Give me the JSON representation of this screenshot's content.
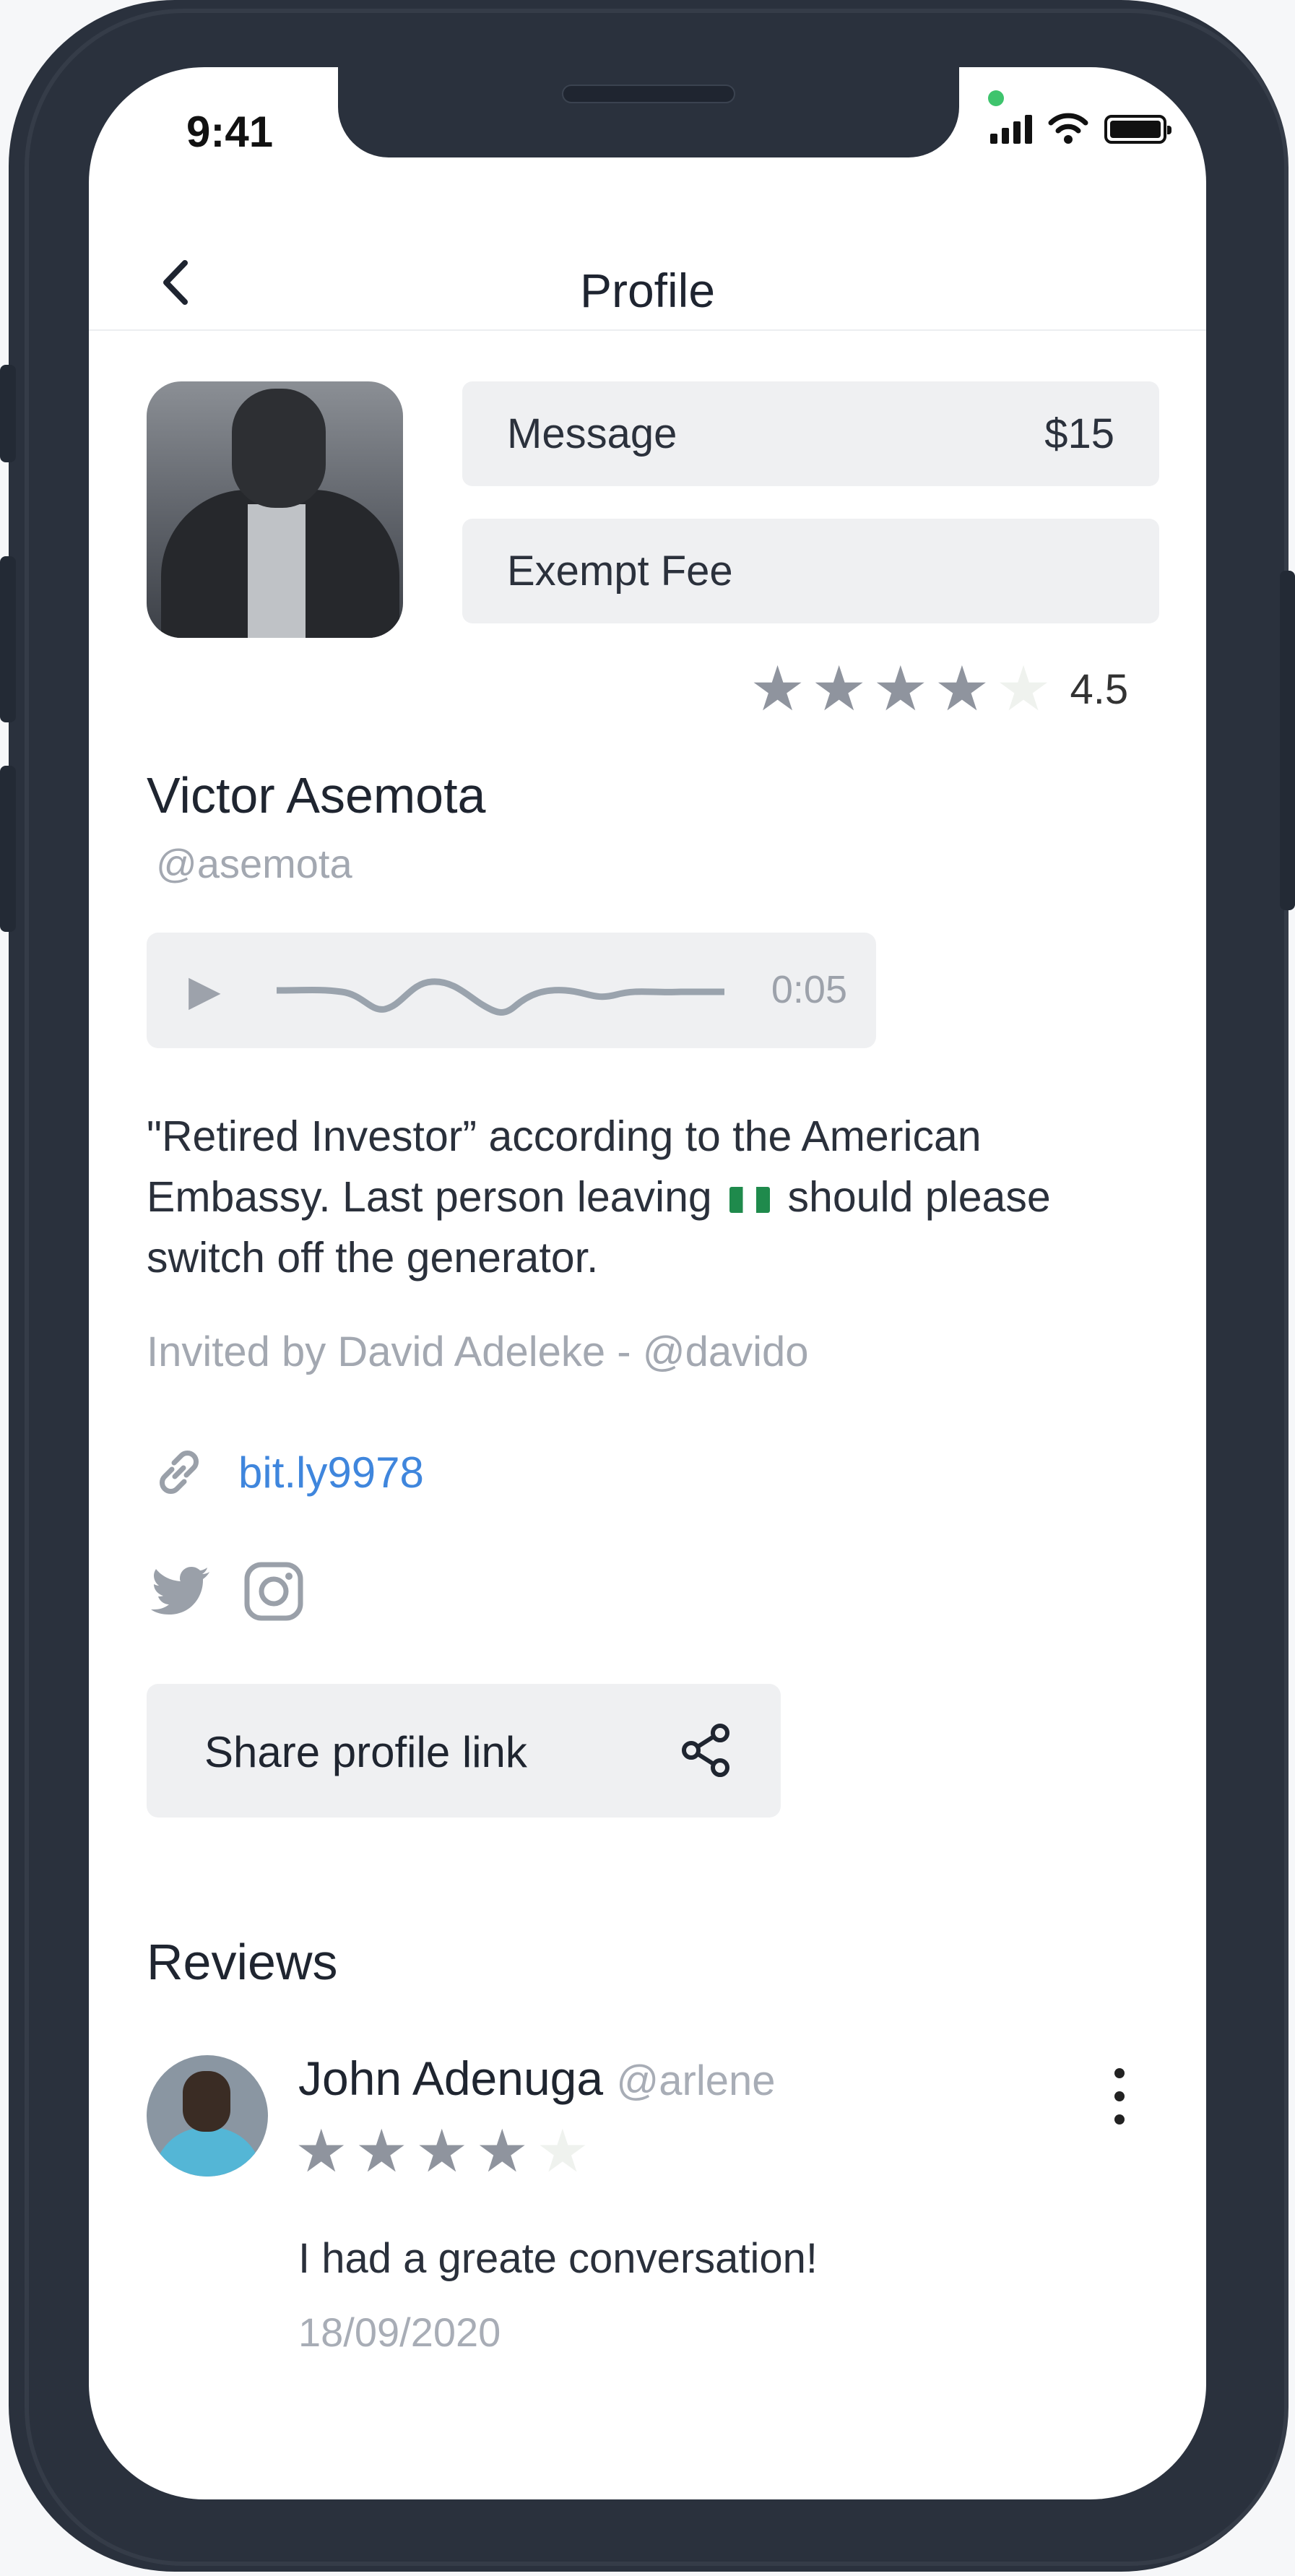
{
  "status_bar": {
    "time": "9:41"
  },
  "header": {
    "back_icon": "chevron-left-icon",
    "title": "Profile"
  },
  "profile": {
    "name": "Victor Asemota",
    "handle": "@asemota",
    "rating": {
      "stars_filled": 4,
      "stars_total": 5,
      "value": "4.5"
    },
    "message_button": {
      "label": "Message",
      "price": "$15"
    },
    "exempt_button": {
      "label": "Exempt Fee"
    },
    "audio": {
      "duration": "0:05",
      "icon": "play-icon"
    },
    "bio_part1": "\"Retired Investor” according to the American Embassy. Last person leaving",
    "bio_part2": "should please switch off the generator.",
    "invited_by": "Invited by David Adeleke - @davido",
    "link": "bit.ly9978",
    "social_icons": [
      "twitter-icon",
      "instagram-icon"
    ],
    "share_button": {
      "label": "Share profile link",
      "icon": "share-icon"
    }
  },
  "reviews": {
    "title": "Reviews",
    "items": [
      {
        "name": "John Adenuga",
        "handle": "@arlene",
        "stars_filled": 4,
        "stars_total": 5,
        "text": "I had a greate conversation!",
        "date": "18/09/2020"
      }
    ]
  },
  "colors": {
    "link": "#3f86dd",
    "muted_text": "#a3a8b1",
    "button_bg": "#eff0f2",
    "frame": "#2a313d",
    "star": "#8f949e"
  }
}
